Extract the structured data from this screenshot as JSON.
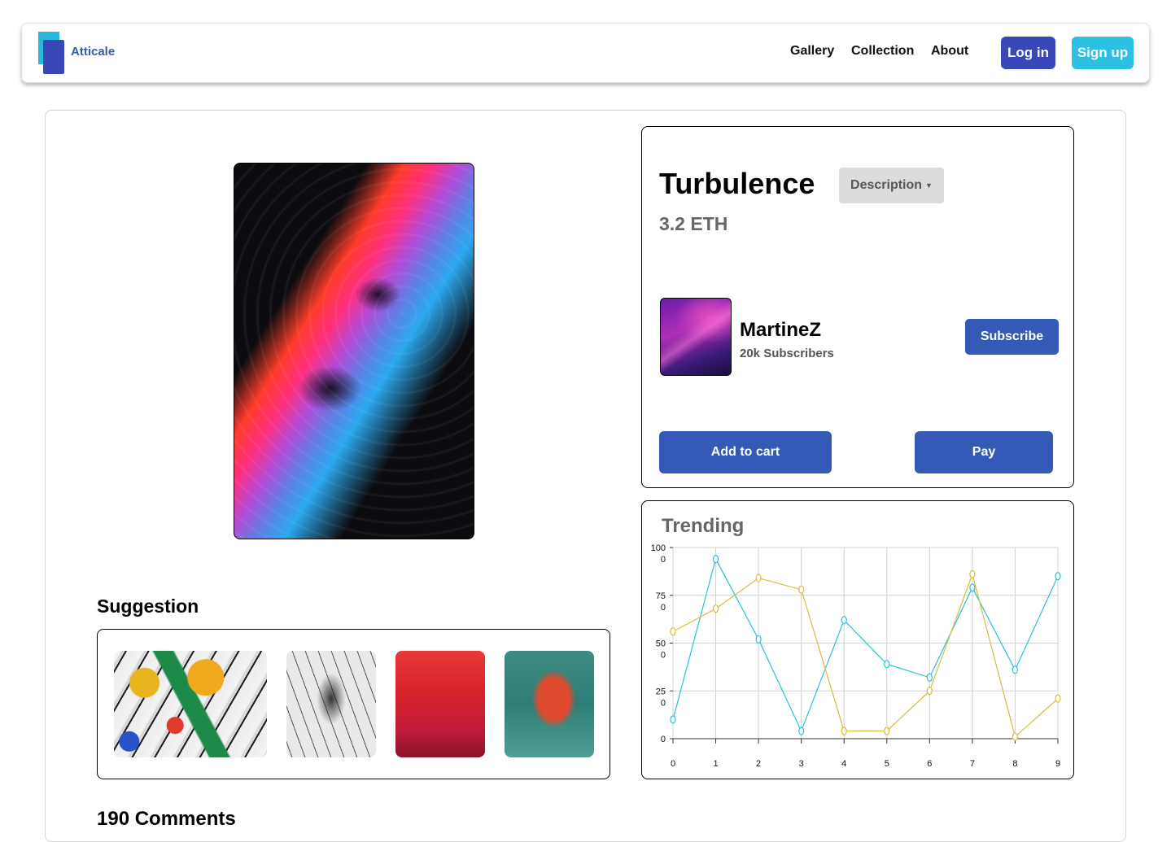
{
  "nav": {
    "brand": "Atticale",
    "links": [
      "Gallery",
      "Collection",
      "About"
    ],
    "login_label": "Log in",
    "signup_label": "Sign up"
  },
  "artwork": {
    "title": "Turbulence",
    "description_label": "Description",
    "price": "3.2 ETH"
  },
  "creator": {
    "name": "MartineZ",
    "subscribers": "20k Subscribers",
    "subscribe_label": "Subscribe"
  },
  "actions": {
    "add_to_cart_label": "Add to cart",
    "pay_label": "Pay"
  },
  "suggestion": {
    "title": "Suggestion",
    "count": 4
  },
  "comments": {
    "title": "190 Comments"
  },
  "colors": {
    "primary": "#3559b7",
    "login": "#3a47b8",
    "signup": "#2cc0e2",
    "series_cyan": "#2bc0d8",
    "series_gold": "#d6bd3c"
  },
  "chart_data": {
    "type": "line",
    "title": "Trending",
    "x": [
      0,
      1,
      2,
      3,
      4,
      5,
      6,
      7,
      8,
      9
    ],
    "ylim": [
      0,
      1000
    ],
    "y_tick_labels": [
      [
        "100",
        "0"
      ],
      [
        "75",
        "0"
      ],
      [
        "50",
        "0"
      ],
      [
        "25",
        "0"
      ],
      [
        "0"
      ]
    ],
    "y_tick_values": [
      1000,
      750,
      500,
      250,
      0
    ],
    "grid": true,
    "series": [
      {
        "color": "#2bc0d8",
        "values": [
          100,
          940,
          520,
          40,
          620,
          390,
          320,
          790,
          360,
          850
        ]
      },
      {
        "color": "#d6bd3c",
        "values": [
          560,
          680,
          840,
          780,
          40,
          40,
          250,
          860,
          10,
          210
        ]
      }
    ]
  }
}
